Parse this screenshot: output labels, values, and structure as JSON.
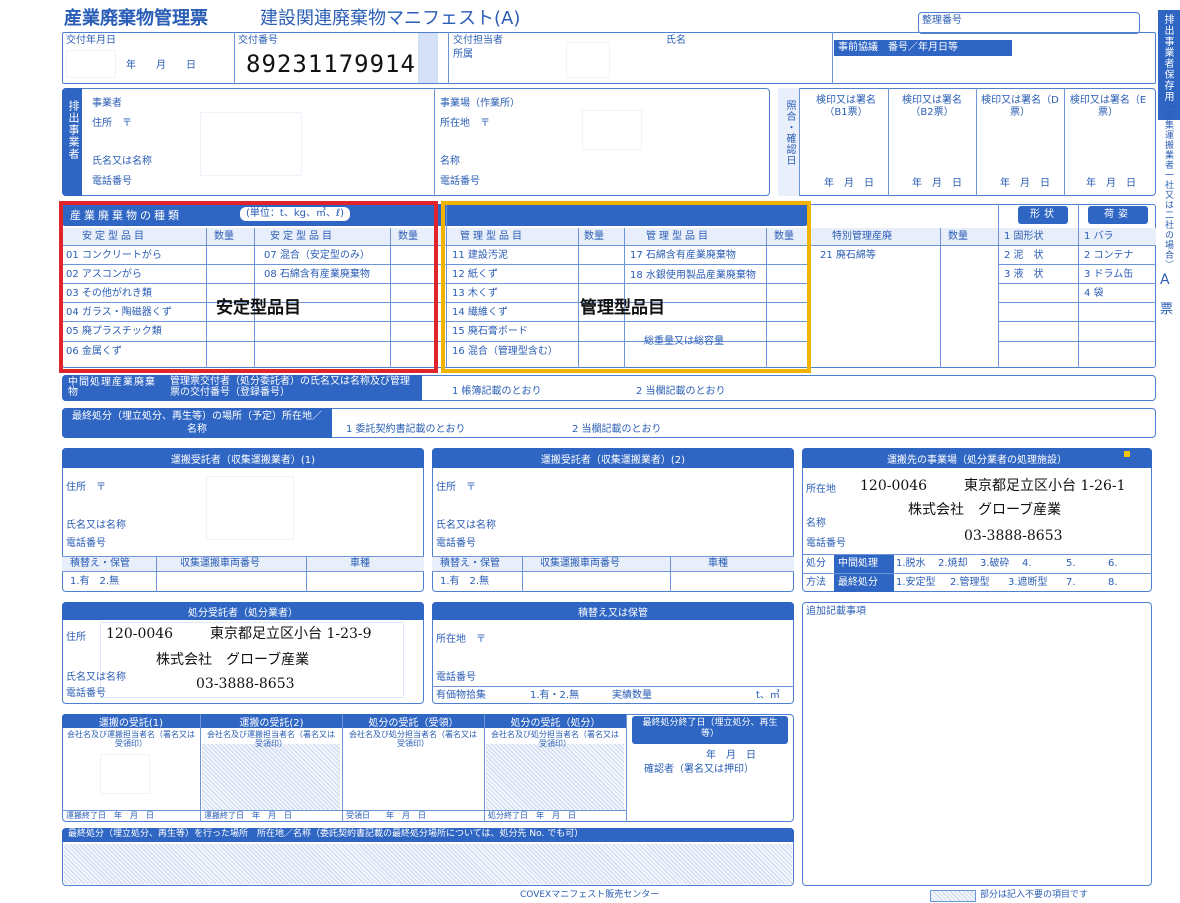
{
  "header": {
    "title_main": "産業廃棄物管理票",
    "title_sub": "建設関連廃棄物マニフェスト(A)",
    "seiri_label": "整理番号",
    "issue_date_label": "交付年月日",
    "issue_date_units": "年　　月　　日",
    "issue_no_label": "交付番号",
    "issue_no": "89231179914",
    "issuer_label": "交付担当者",
    "issuer_name_label": "氏名",
    "issuer_dept_label": "所属",
    "prior_label": "事前協議　番号／年月日等",
    "side_tab_1": "排出事業者保存用",
    "side_tab_2": "（収集運搬業者一社又は二社の場合）",
    "side_tab_3": "A",
    "side_tab_4": "票"
  },
  "discharger": {
    "side": "排出事業者",
    "company_label": "事業者",
    "address_label": "住所　〒",
    "name_label": "氏名又は名称",
    "tel_label": "電話番号",
    "site_label": "事業場（作業所）",
    "site_address_label": "所在地　〒",
    "site_name_label": "名称",
    "site_tel_label": "電話番号"
  },
  "verify": {
    "side": "照合・確認日",
    "cols": [
      "検印又は署名（B1票）",
      "検印又は署名（B2票）",
      "検印又は署名（D票）",
      "検印又は署名（E票）"
    ],
    "date_units": "年　月　日"
  },
  "waste": {
    "title": "産業廃棄物の種類",
    "unit_note": "(単位：t、kg、㎥、ℓ)",
    "col_stable": "安定型品目",
    "col_qty": "数量",
    "col_managed": "管理型品目",
    "col_special": "特別管理産廃",
    "stable_left": [
      "01 コンクリートがら",
      "02 アスコンがら",
      "03 その他がれき類",
      "04 ガラス・陶磁器くず",
      "05 廃プラスチック類",
      "06 金属くず"
    ],
    "stable_right": [
      "07 混合（安定型のみ）",
      "08 石綿含有産業廃棄物"
    ],
    "managed_left": [
      "11 建設汚泥",
      "12 紙くず",
      "13 木くず",
      "14 繊維くず",
      "15 廃石膏ボード",
      "16 混合（管理型含む）"
    ],
    "managed_right": [
      "17 石綿含有産業廃棄物",
      "18 水銀使用製品産業廃棄物"
    ],
    "total_label": "総重量又は総容量",
    "special": [
      "21 廃石綿等"
    ],
    "shape_title": "形状",
    "shapes": [
      "1 固形状",
      "2 泥　状",
      "3 液　状"
    ],
    "packing_title": "荷姿",
    "packings": [
      "1 バラ",
      "2 コンテナ",
      "3 ドラム缶",
      "4 袋"
    ],
    "overlay_stable": "安定型品目",
    "overlay_managed": "管理型品目"
  },
  "intermediate": {
    "label": "中間処理産業廃棄物",
    "desc": "管理票交付者（処分委託者）の氏名又は名称及び管理票の交付番号（登録番号）",
    "opt1": "1 帳簿記載のとおり",
    "opt2": "2 当欄記載のとおり"
  },
  "final_place": {
    "label": "最終処分（埋立処分、再生等）の場所（予定）所在地／名称",
    "opt1": "1 委託契約書記載のとおり",
    "opt2": "2 当欄記載のとおり"
  },
  "transporter1": {
    "title": "運搬受託者（収集運搬業者）(1)",
    "address_label": "住所　〒",
    "name_label": "氏名又は名称",
    "tel_label": "電話番号",
    "col1": "積替え・保管",
    "col2": "収集運搬車両番号",
    "col3": "車種",
    "opts": "1.有　2.無"
  },
  "transporter2": {
    "title": "運搬受託者（収集運搬業者）(2)",
    "address_label": "住所　〒",
    "name_label": "氏名又は名称",
    "tel_label": "電話番号",
    "col1": "積替え・保管",
    "col2": "収集運搬車両番号",
    "col3": "車種",
    "opts": "1.有　2.無"
  },
  "destination": {
    "title": "運搬先の事業場（処分業者の処理施設）",
    "address_label": "所在地",
    "postal": "120-0046",
    "address": "東京都足立区小台 1-26-1",
    "name_label": "名称",
    "name": "株式会社　グローブ産業",
    "tel_label": "電話番号",
    "tel": "03-3888-8653",
    "method_label_1": "処分",
    "method_label_2": "方法",
    "mid_label": "中間処理",
    "mid_opts": [
      "1.脱水",
      "2.焼却",
      "3.破砕",
      "4.",
      "5.",
      "6."
    ],
    "fin_label": "最終処分",
    "fin_opts": [
      "1.安定型",
      "2.管理型",
      "3.遮断型",
      "7.",
      "8."
    ]
  },
  "disposer": {
    "title": "処分受託者（処分業者）",
    "address_label": "住所",
    "postal": "120-0046",
    "address": "東京都足立区小台 1-23-9",
    "name_label": "氏名又は名称",
    "name": "株式会社　グローブ産業",
    "tel_label": "電話番号",
    "tel": "03-3888-8653"
  },
  "storage": {
    "title": "積替え又は保管",
    "address_label": "所在地　〒",
    "tel_label": "電話番号",
    "valuable_label": "有価物拾集",
    "valuable_opts": "1.有・2.無",
    "actual_label": "実績数量",
    "unit": "t、㎥"
  },
  "notes": {
    "label": "追加記載事項"
  },
  "receipts": {
    "r1_title": "運搬の受託(1)",
    "r2_title": "運搬の受託(2)",
    "r3_title": "処分の受託（受領）",
    "r4_title": "処分の受託（処分）",
    "r1_sub": "会社名及び運搬担当者名（署名又は受領印）",
    "r2_sub": "会社名及び運搬担当者名（署名又は受領印）",
    "r3_sub": "会社名及び処分担当者名（署名又は受領印）",
    "r4_sub": "会社名及び処分担当者名（署名又は受領印）",
    "r1_date": "運搬終了日　年　月　日",
    "r2_date": "運搬終了日　年　月　日",
    "r3_date": "受領日　　年　月　日",
    "r4_date": "処分終了日　年　月　日",
    "final_title": "最終処分終了日（埋立処分、再生等）",
    "final_date": "年　月　日",
    "final_confirm": "確認者（署名又は押印）"
  },
  "final_done": {
    "label": "最終処分（埋立処分、再生等）を行った場所　所在地／名称（委託契約書記載の最終処分場所については、処分先 No. でも可）"
  },
  "footer": {
    "center": "COVEXマニフェスト販売センター",
    "note": "部分は記入不要の項目です"
  },
  "colors": {
    "ink": "#2a5db5",
    "bar": "#2f66c4",
    "highlight_red": "#e0242b",
    "highlight_yellow": "#f0b400"
  }
}
